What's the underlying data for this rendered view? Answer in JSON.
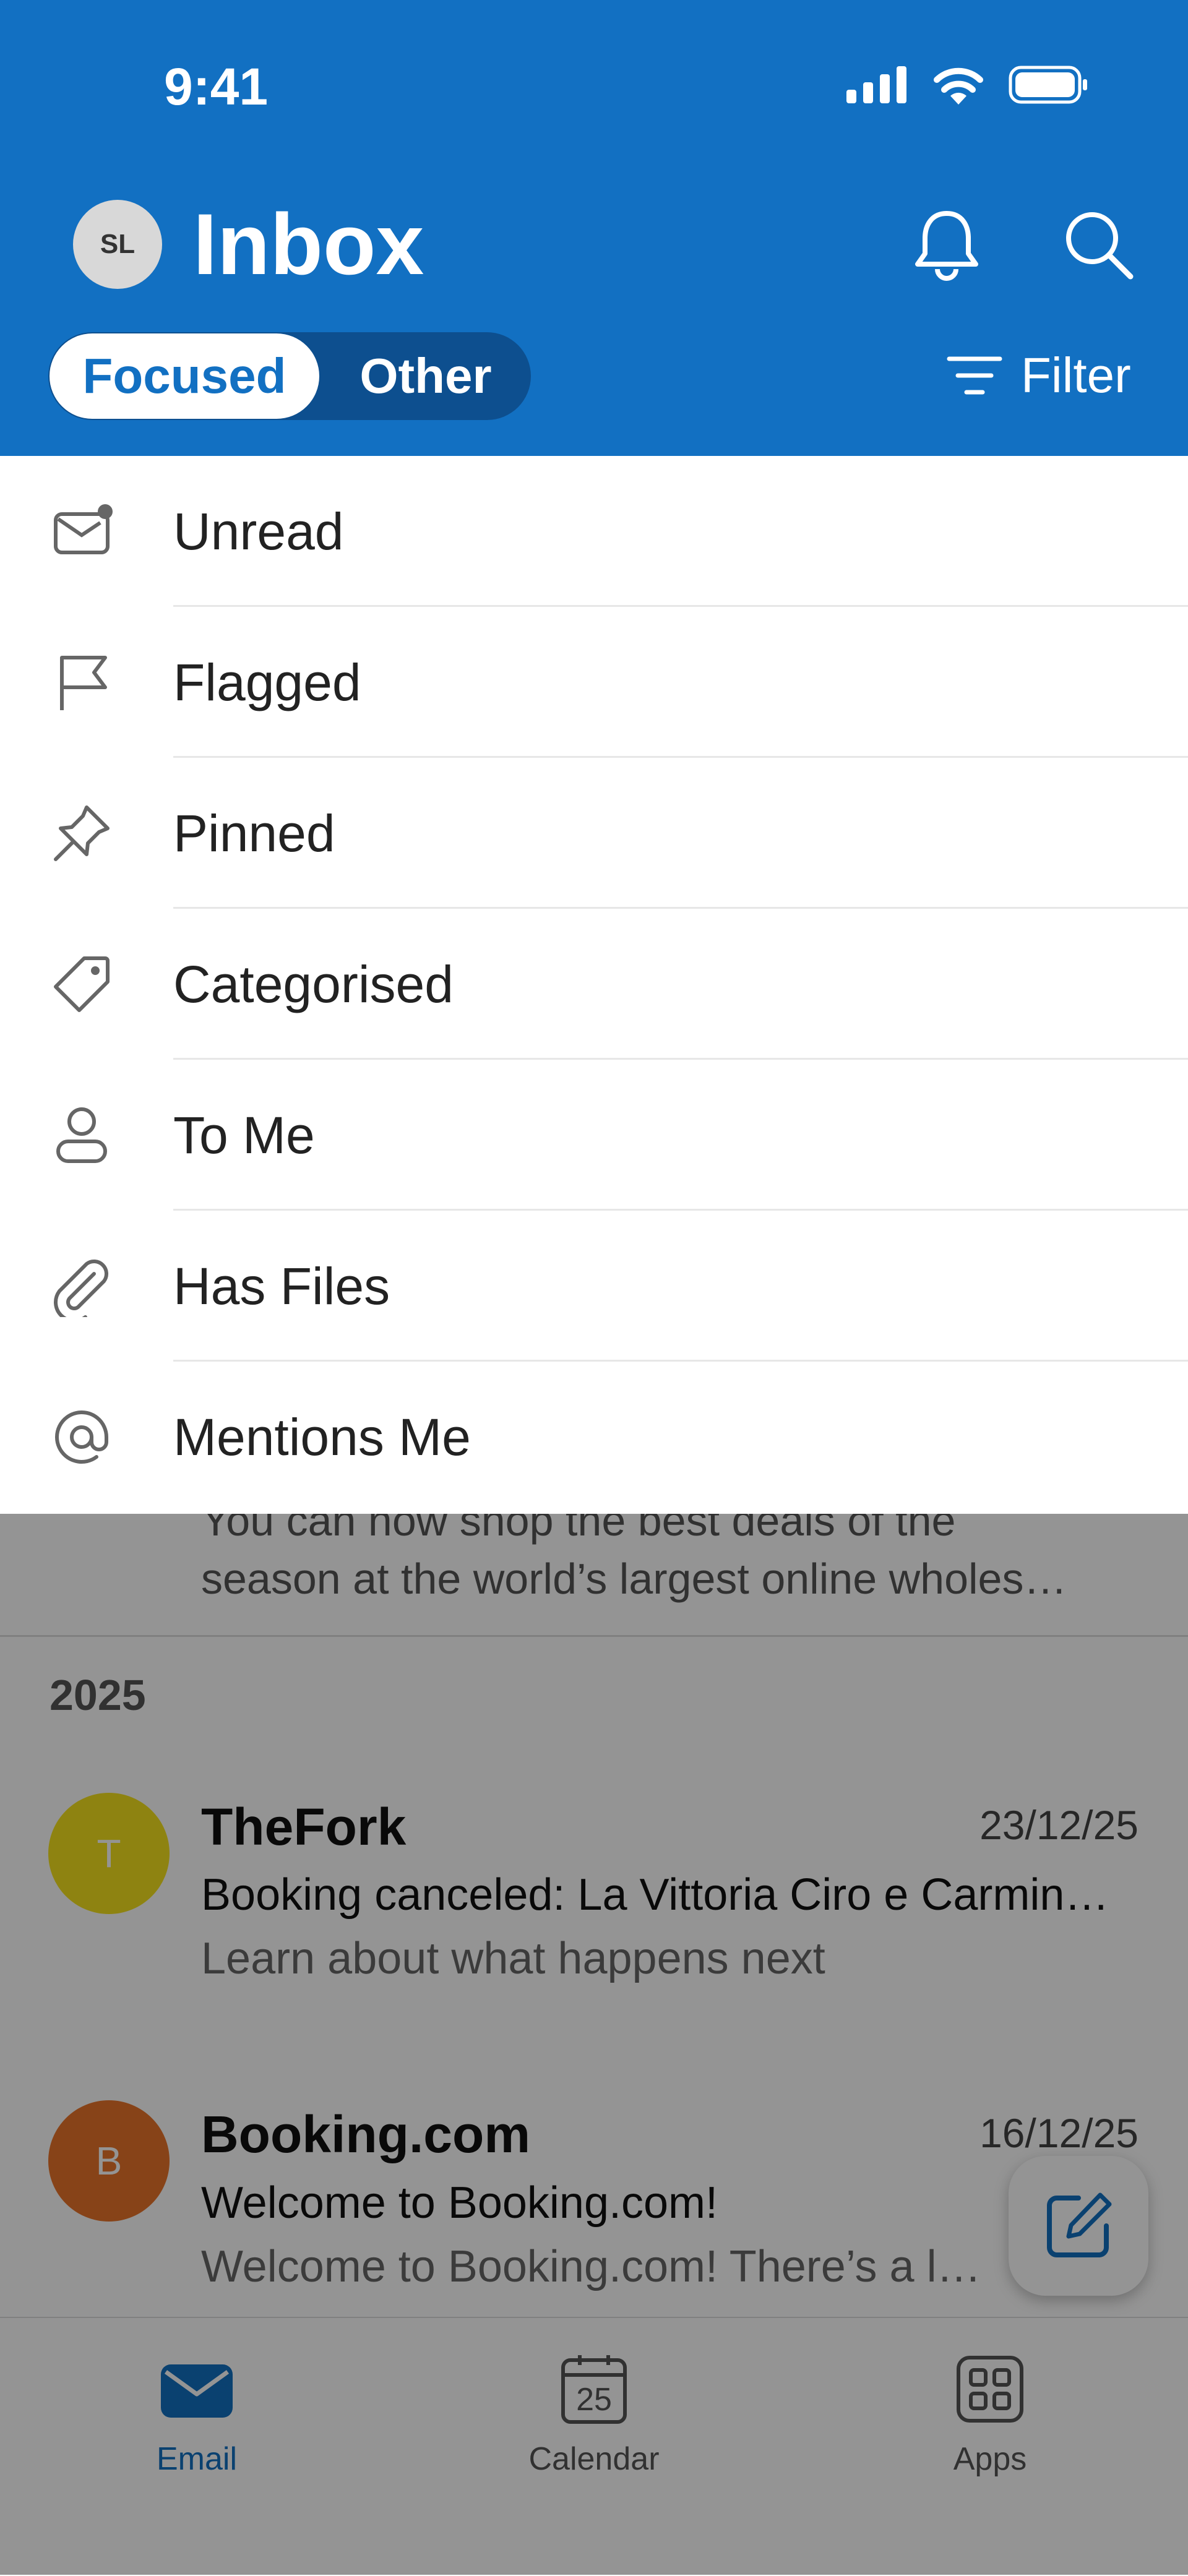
{
  "status_bar": {
    "time": "9:41"
  },
  "header": {
    "avatar_initials": "SL",
    "title": "Inbox",
    "segments": {
      "focused": "Focused",
      "other": "Other"
    },
    "filter_label": "Filter",
    "accent_color": "#1270c2"
  },
  "filter_menu": {
    "items": [
      {
        "label": "Unread",
        "icon": "unread-mail-icon"
      },
      {
        "label": "Flagged",
        "icon": "flag-icon"
      },
      {
        "label": "Pinned",
        "icon": "pin-icon"
      },
      {
        "label": "Categorised",
        "icon": "tag-icon"
      },
      {
        "label": "To Me",
        "icon": "person-icon"
      },
      {
        "label": "Has Files",
        "icon": "paperclip-icon"
      },
      {
        "label": "Mentions Me",
        "icon": "at-icon"
      }
    ]
  },
  "mail_list": {
    "partial_preview_line1": "You can now shop the best deals of the",
    "partial_preview_line2": "season at the world’s largest online wholes…",
    "section_year": "2025",
    "messages": [
      {
        "avatar_letter": "T",
        "avatar_color": "#f5e21e",
        "sender": "TheFork",
        "date": "23/12/25",
        "subject": "Booking canceled: La Vittoria Ciro e Carmin…",
        "snippet": "Learn about what happens next"
      },
      {
        "avatar_letter": "B",
        "avatar_color": "#e8742a",
        "sender": "Booking.com",
        "date": "16/12/25",
        "subject": "Welcome to Booking.com!",
        "snippet": "Welcome to Booking.com! There’s a lot of"
      }
    ]
  },
  "tab_bar": {
    "email": "Email",
    "calendar": "Calendar",
    "calendar_day": "25",
    "apps": "Apps"
  }
}
